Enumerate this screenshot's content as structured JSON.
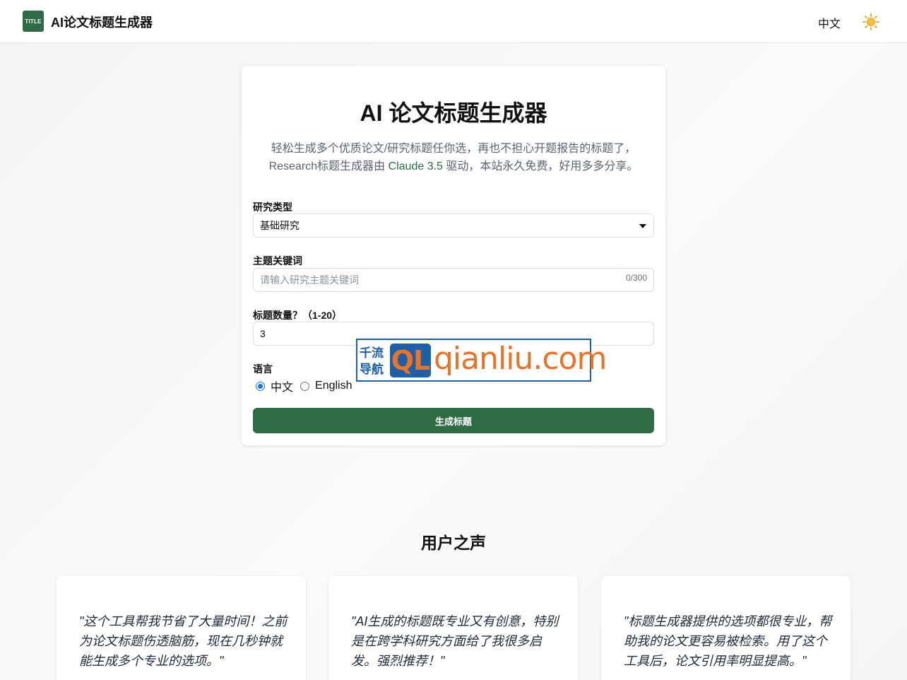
{
  "header": {
    "logo_text": "TITLE",
    "brand": "AI论文标题生成器",
    "language": "中文",
    "theme_icon": "sun-icon"
  },
  "form": {
    "title": "AI 论文标题生成器",
    "desc_line1": "轻松生成多个优质论文/研究标题任你选，再也不担心开题报告的标题了，",
    "desc_line2_prefix": "Research标题生成器由 ",
    "desc_line2_accent": "Claude 3.5",
    "desc_line2_suffix": " 驱动，本站永久免费，好用多多分享。",
    "research_type": {
      "label": "研究类型",
      "value": "基础研究"
    },
    "keywords": {
      "label": "主题关键词",
      "placeholder": "请输入研究主题关键词",
      "counter": "0/300"
    },
    "count": {
      "label": "标题数量？（1-20）",
      "value": "3"
    },
    "language": {
      "label": "语言",
      "options": [
        "中文",
        "English"
      ],
      "selected": "中文"
    },
    "submit_label": "生成标题",
    "accent_color": "#2f6b45"
  },
  "watermark": {
    "cn_line1": "千流",
    "cn_line2": "导航",
    "badge": "QL",
    "text": "qianliu.com"
  },
  "testimonials": {
    "title": "用户之声",
    "items": [
      {
        "quote": "\"这个工具帮我节省了大量时间！之前为论文标题伤透脑筋，现在几秒钟就能生成多个专业的选项。\""
      },
      {
        "quote": "\"AI生成的标题既专业又有创意，特别是在跨学科研究方面给了我很多启发。强烈推荐！\""
      },
      {
        "quote": "\"标题生成器提供的选项都很专业，帮助我的论文更容易被检索。用了这个工具后，论文引用率明显提高。\""
      }
    ]
  }
}
